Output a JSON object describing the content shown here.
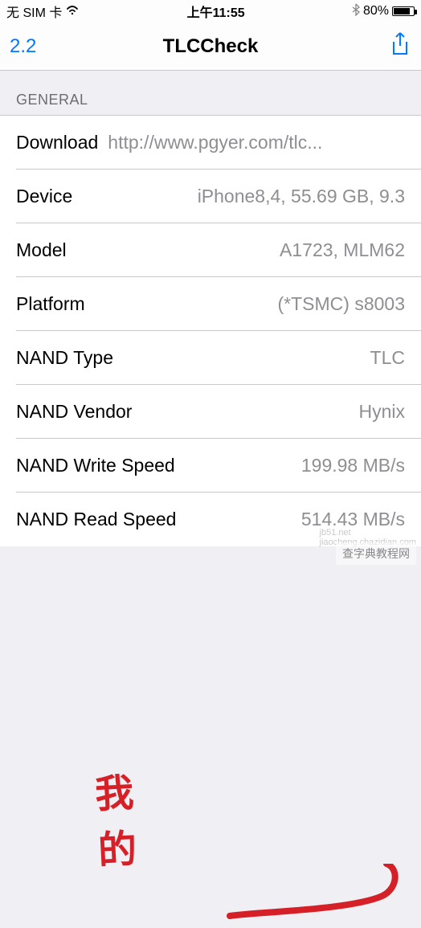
{
  "status_bar": {
    "carrier": "无 SIM 卡",
    "time": "上午11:55",
    "battery_percent": "80%"
  },
  "nav": {
    "left": "2.2",
    "title": "TLCCheck"
  },
  "section_header": "GENERAL",
  "rows": [
    {
      "label": "Download",
      "value": "http://www.pgyer.com/tlc..."
    },
    {
      "label": "Device",
      "value": "iPhone8,4, 55.69 GB, 9.3"
    },
    {
      "label": "Model",
      "value": "A1723, MLM62"
    },
    {
      "label": "Platform",
      "value": "(*TSMC) s8003"
    },
    {
      "label": "NAND Type",
      "value": "TLC"
    },
    {
      "label": "NAND Vendor",
      "value": "Hynix"
    },
    {
      "label": "NAND Write Speed",
      "value": "199.98 MB/s"
    },
    {
      "label": "NAND Read Speed",
      "value": "514.43 MB/s"
    }
  ],
  "annotation": {
    "text": "我的"
  },
  "watermark": "查字典教程网"
}
